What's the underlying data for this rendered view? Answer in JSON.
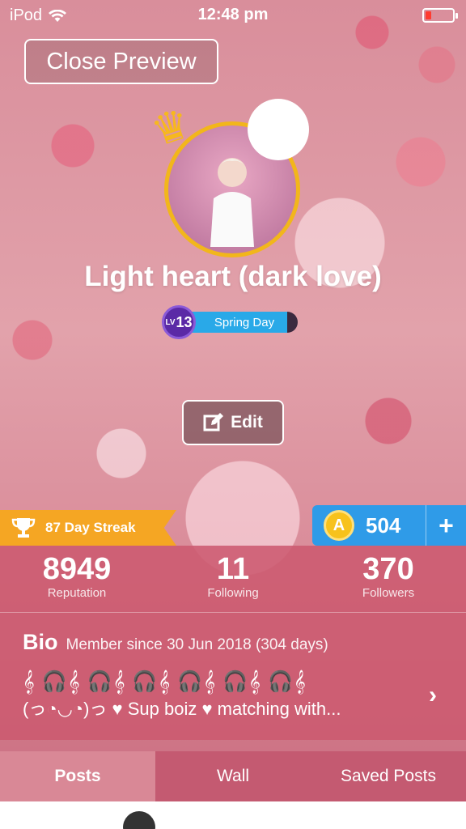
{
  "status": {
    "carrier": "iPod",
    "time": "12:48 pm",
    "wifi_icon": "wifi-icon",
    "battery_icon": "battery-icon"
  },
  "close_preview": {
    "label": "Close Preview"
  },
  "profile": {
    "name": "Light heart (dark love)",
    "crown_icon": "crown-icon",
    "mood_emoji": "😰",
    "level": {
      "prefix": "LV",
      "number": "13",
      "title": "Spring Day",
      "progress": 0.9
    }
  },
  "edit": {
    "label": "Edit"
  },
  "streak": {
    "label": "87 Day Streak"
  },
  "coins": {
    "symbol": "A",
    "count": "504",
    "plus": "+"
  },
  "stats": [
    {
      "value": "8949",
      "label": "Reputation"
    },
    {
      "value": "11",
      "label": "Following"
    },
    {
      "value": "370",
      "label": "Followers"
    }
  ],
  "bio": {
    "title": "Bio",
    "member_since": "Member since 30 Jun 2018 (304 days)",
    "notes": "𝄞 🎧𝄞 🎧𝄞 🎧𝄞 🎧𝄞 🎧𝄞 🎧𝄞",
    "text": "(っ◔◡◔)っ ♥ Sup boiz ♥ matching with...",
    "arrow": "›"
  },
  "tabs": [
    {
      "label": "Posts",
      "active": true
    },
    {
      "label": "Wall",
      "active": false
    },
    {
      "label": "Saved Posts",
      "active": false
    }
  ],
  "colors": {
    "accent_gold": "#f2b61b",
    "streak": "#f5a623",
    "coins": "#2f9be8",
    "panel": "#cc5a70"
  }
}
